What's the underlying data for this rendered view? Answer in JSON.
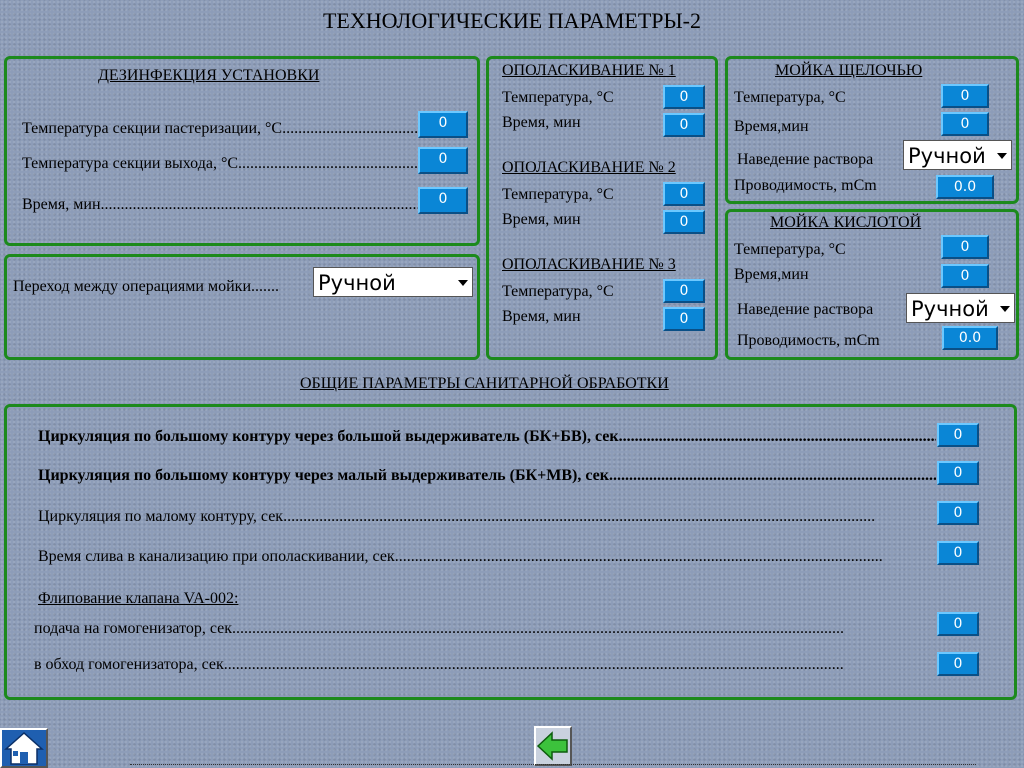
{
  "page_title": "ТЕХНОЛОГИЧЕСКИЕ ПАРАМЕТРЫ-2",
  "disinfection": {
    "heading": "ДЕЗИНФЕКЦИЯ УСТАНОВКИ",
    "rows": [
      {
        "label": "Температура секции пастеризации, °С........................................",
        "value": "0"
      },
      {
        "label": "Температура секции выхода, °С.....................................................",
        "value": "0"
      },
      {
        "label": "Время, мин............................................................................................",
        "value": "0"
      }
    ]
  },
  "transition": {
    "label": "Переход между операциями мойки.......",
    "selected": "Ручной"
  },
  "rinse": [
    {
      "heading": "ОПОЛАСКИВАНИЕ № 1",
      "temp_label": "Температура, °С",
      "temp_value": "0",
      "time_label": "Время, мин",
      "time_value": "0"
    },
    {
      "heading": "ОПОЛАСКИВАНИЕ № 2",
      "temp_label": "Температура, °С",
      "temp_value": "0",
      "time_label": "Время, мин",
      "time_value": "0"
    },
    {
      "heading": "ОПОЛАСКИВАНИЕ № 3",
      "temp_label": "Температура, °С",
      "temp_value": "0",
      "time_label": "Время, мин",
      "time_value": "0"
    }
  ],
  "alkali": {
    "heading": "МОЙКА ЩЕЛОЧЬЮ",
    "temp_label": "Температура, °С",
    "temp_value": "0",
    "time_label": "Время,мин",
    "time_value": "0",
    "solution_label": "Наведение раствора",
    "solution_selected": "Ручной",
    "cond_label": "Проводимость, mCm",
    "cond_value": "0.0"
  },
  "acid": {
    "heading": "МОЙКА КИСЛОТОЙ",
    "temp_label": "Температура, °С",
    "temp_value": "0",
    "time_label": "Время,мин",
    "time_value": "0",
    "solution_label": "Наведение раствора",
    "solution_selected": "Ручной",
    "cond_label": "Проводимость, mCm",
    "cond_value": "0.0"
  },
  "general": {
    "heading": "ОБЩИЕ ПАРАМЕТРЫ САНИТАРНОЙ ОБРАБОТКИ",
    "rows": [
      {
        "label": "Циркуляция по большому контуру через большой выдерживатель (БК+БВ), сек.......................................................................................",
        "value": "0"
      },
      {
        "label": "Циркуляция по большому контуру через малый выдерживатель (БК+МВ), сек.........................................................................................",
        "value": "0"
      },
      {
        "label": "Циркуляция по малому контуру, сек....................................................................................................................................................",
        "value": "0"
      },
      {
        "label": "Время слива в канализацию при ополаскивании, сек..........................................................................................................................",
        "value": "0"
      }
    ],
    "valve_heading": "Флипование клапана VA-002:",
    "valve_rows": [
      {
        "label": "подача на гомогенизатор, сек.........................................................................................................................................................",
        "value": "0"
      },
      {
        "label": "в обход гомогенизатора, сек...........................................................................................................................................................",
        "value": "0"
      }
    ]
  },
  "nav": {
    "home_icon": "home-icon",
    "back_icon": "back-arrow-icon"
  }
}
